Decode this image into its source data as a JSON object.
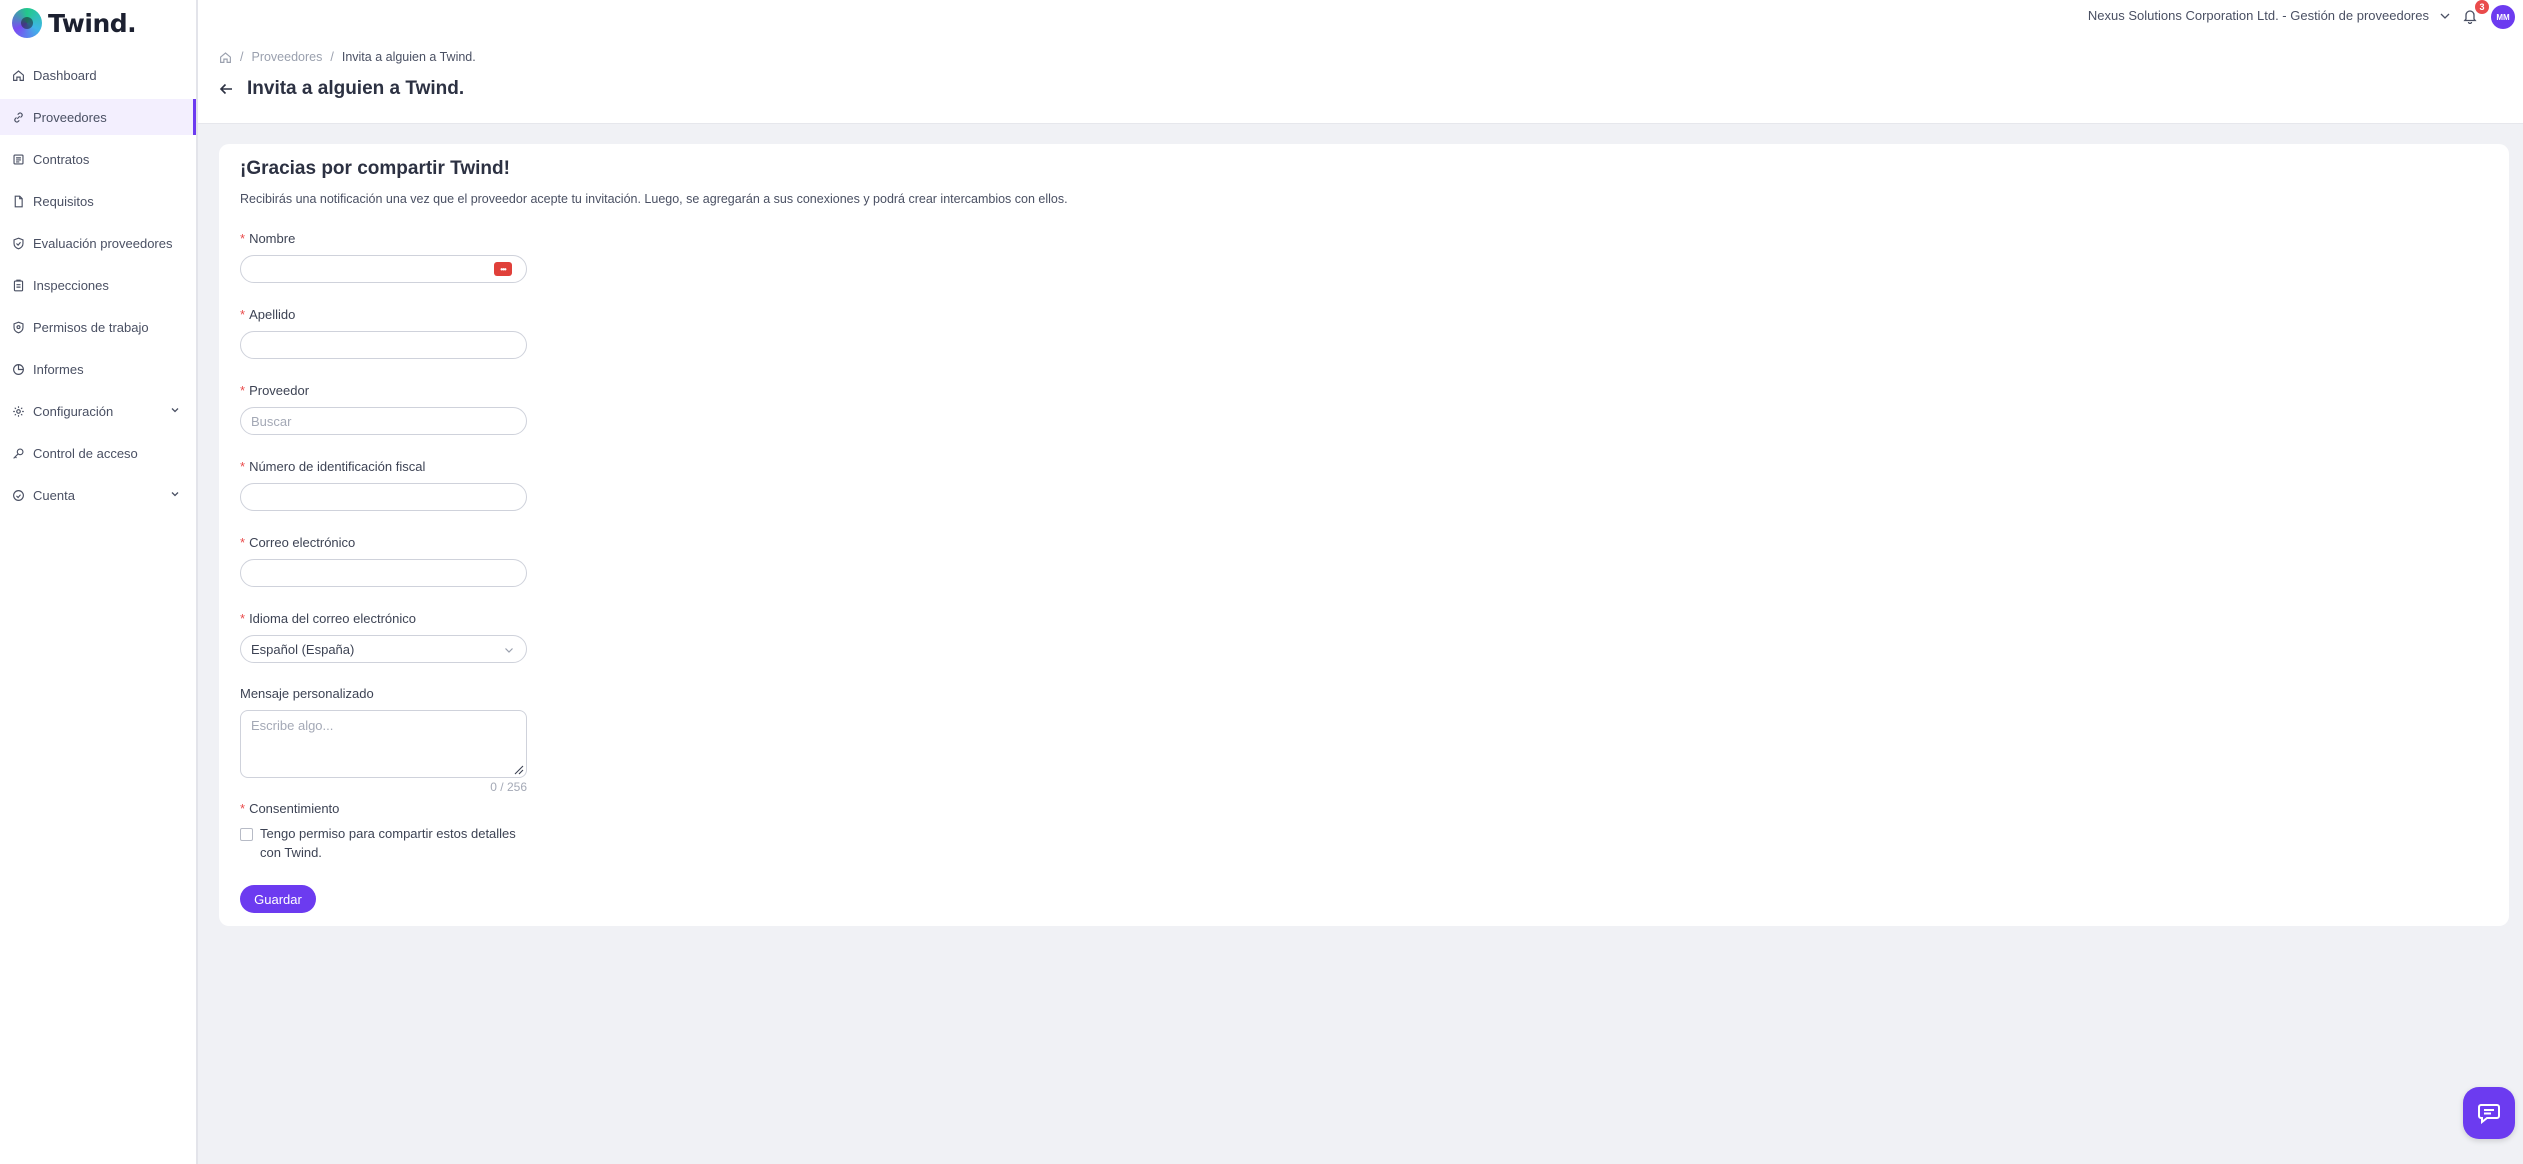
{
  "app": {
    "logo_text": "Twind."
  },
  "sidebar": {
    "items": [
      {
        "label": "Dashboard",
        "icon": "home-icon"
      },
      {
        "label": "Proveedores",
        "icon": "link-icon",
        "active": true
      },
      {
        "label": "Contratos",
        "icon": "contract-icon"
      },
      {
        "label": "Requisitos",
        "icon": "document-icon"
      },
      {
        "label": "Evaluación proveedores",
        "icon": "shield-check-icon"
      },
      {
        "label": "Inspecciones",
        "icon": "clipboard-icon"
      },
      {
        "label": "Permisos de trabajo",
        "icon": "shield-icon"
      },
      {
        "label": "Informes",
        "icon": "chart-icon"
      },
      {
        "label": "Configuración",
        "icon": "gear-icon",
        "expandable": true
      },
      {
        "label": "Control de acceso",
        "icon": "key-icon"
      },
      {
        "label": "Cuenta",
        "icon": "user-circle-icon",
        "expandable": true
      }
    ]
  },
  "header": {
    "org_selector": "Nexus Solutions Corporation Ltd. - Gestión de proveedores",
    "notification_count": "3",
    "avatar_initials": "MM",
    "breadcrumb": {
      "level1": "Proveedores",
      "current": "Invita a alguien a Twind."
    },
    "page_title": "Invita a alguien a Twind."
  },
  "form": {
    "title": "¡Gracias por compartir Twind!",
    "subtitle": "Recibirás una notificación una vez que el proveedor acepte tu invitación. Luego, se agregarán a sus conexiones y podrá crear intercambios con ellos.",
    "required_mark": "*",
    "nombre_label": "Nombre",
    "nombre_value": "",
    "apellido_label": "Apellido",
    "apellido_value": "",
    "proveedor_label": "Proveedor",
    "proveedor_placeholder": "Buscar",
    "nif_label": "Número de identificación fiscal",
    "nif_value": "",
    "email_label": "Correo electrónico",
    "email_value": "",
    "language_label": "Idioma del correo electrónico",
    "language_value": "Español (España)",
    "message_label": "Mensaje personalizado",
    "message_placeholder": "Escribe algo...",
    "message_counter": "0 / 256",
    "consent_label": "Consentimiento",
    "consent_text": "Tengo permiso para compartir estos detalles con Twind.",
    "consent_checked": false,
    "save_label": "Guardar"
  },
  "colors": {
    "accent": "#6c3bf0",
    "danger": "#e94b4b",
    "background": "#f0f1f5"
  }
}
